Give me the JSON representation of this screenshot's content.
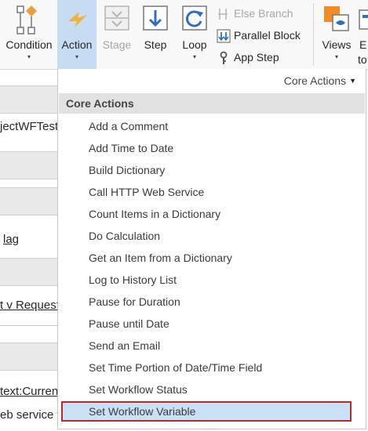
{
  "ribbon": {
    "condition_label": "Condition",
    "action_label": "Action",
    "stage_label": "Stage",
    "step_label": "Step",
    "loop_label": "Loop",
    "else_branch_label": "Else Branch",
    "parallel_block_label": "Parallel Block",
    "app_step_label": "App Step",
    "views_label": "Views",
    "overflow_label_1": "E",
    "overflow_label_2": "to",
    "dropdown_arrow": "▾",
    "colors": {
      "selected_bg": "#c5dcf3",
      "icon_blue": "#2e6fbe",
      "icon_orange": "#e8a23b",
      "views_orange": "#f28a25"
    }
  },
  "background": {
    "text_1": "jectWFTest",
    "text_2": "lag",
    "text_3": "t v Request",
    "text_4": "text:Current",
    "text_5": "eb service w"
  },
  "menu": {
    "category_selector": "Core Actions",
    "category_caret": "▼",
    "header": "Core Actions",
    "items": [
      "Add a Comment",
      "Add Time to Date",
      "Build Dictionary",
      "Call HTTP Web Service",
      "Count Items in a Dictionary",
      "Do Calculation",
      "Get an Item from a Dictionary",
      "Log to History List",
      "Pause for Duration",
      "Pause until Date",
      "Send an Email",
      "Set Time Portion of Date/Time Field",
      "Set Workflow Status",
      "Set Workflow Variable"
    ],
    "selected_index": 13,
    "grip": "....",
    "colors": {
      "selection_bg": "#c9e0f7",
      "selection_border": "#b22b2b",
      "header_bg": "#e1e1e1"
    }
  }
}
